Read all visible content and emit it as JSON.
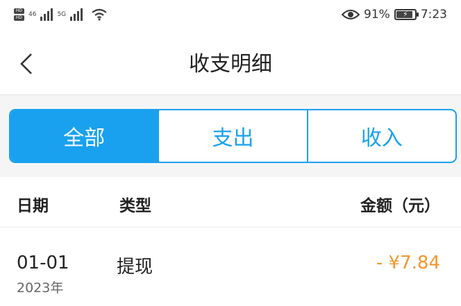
{
  "status_bar": {
    "network_2": "46",
    "network_1": "5G",
    "battery_percent": "91%",
    "battery_level": 0.91,
    "time": "7:23",
    "icons": [
      "hd-icon",
      "signal-icon",
      "wifi-icon",
      "eye-icon",
      "battery-icon"
    ]
  },
  "nav": {
    "title": "收支明细",
    "back_icon": "chevron-left-icon"
  },
  "tabs": [
    {
      "label": "全部",
      "active": true
    },
    {
      "label": "支出",
      "active": false
    },
    {
      "label": "收入",
      "active": false
    }
  ],
  "table": {
    "headers": {
      "date": "日期",
      "type": "类型",
      "amount": "金额（元）"
    },
    "rows": [
      {
        "date": "01-01",
        "year": "2023年",
        "type": "提现",
        "amount": "- ¥7.84"
      }
    ]
  },
  "colors": {
    "accent": "#19a1f0",
    "amount_negative": "#f5962c"
  }
}
